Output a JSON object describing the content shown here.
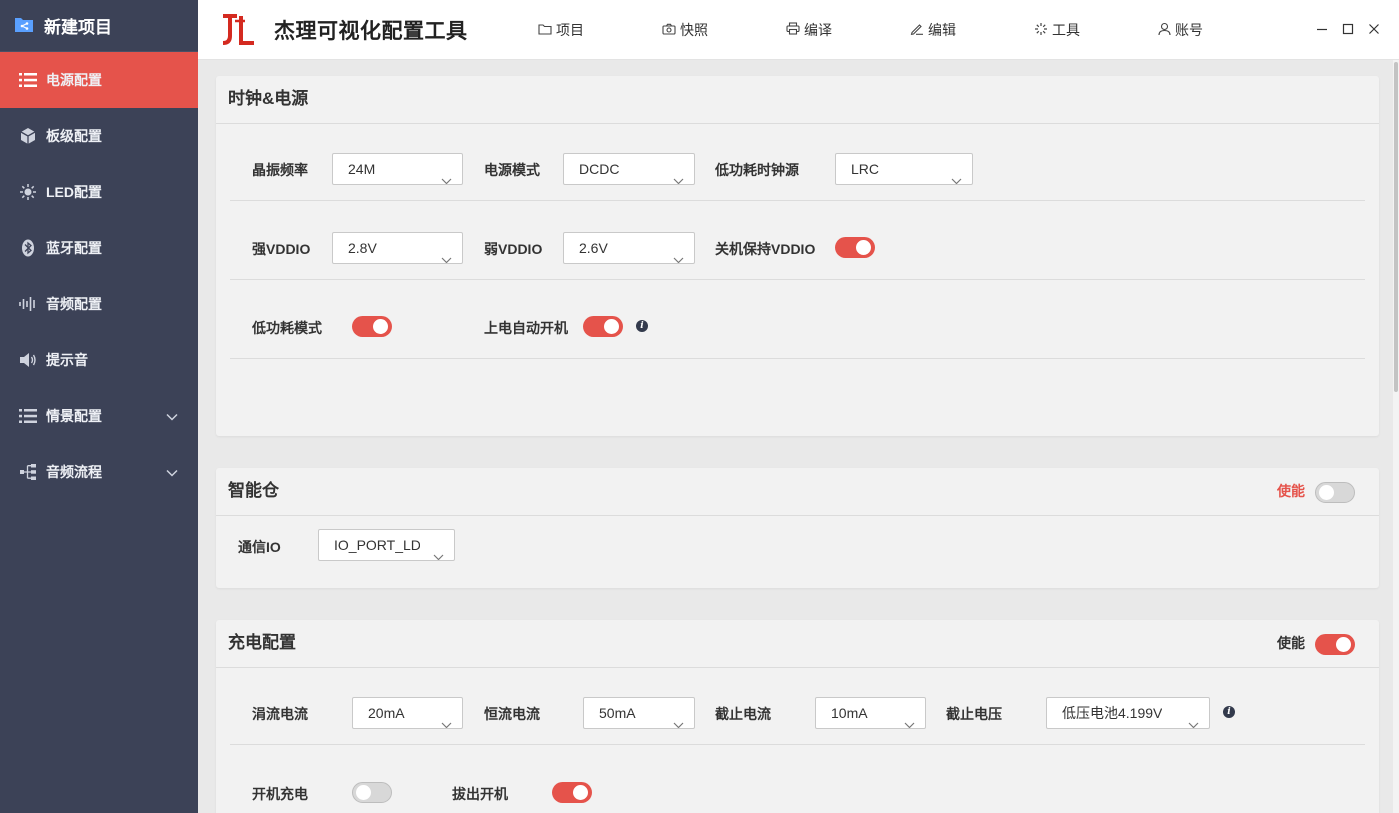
{
  "sidebar": {
    "project_label": "新建项目",
    "items": [
      {
        "label": "电源配置",
        "icon": "list-icon",
        "active": true
      },
      {
        "label": "板级配置",
        "icon": "cube-icon"
      },
      {
        "label": "LED配置",
        "icon": "light-icon"
      },
      {
        "label": "蓝牙配置",
        "icon": "bluetooth-icon"
      },
      {
        "label": "音频配置",
        "icon": "waveform-icon"
      },
      {
        "label": "提示音",
        "icon": "speaker-icon"
      },
      {
        "label": "情景配置",
        "icon": "list-icon",
        "expandable": true
      },
      {
        "label": "音频流程",
        "icon": "flow-icon",
        "expandable": true
      }
    ]
  },
  "header": {
    "title": "杰理可视化配置工具",
    "menu": [
      {
        "label": "项目",
        "icon": "folder-icon"
      },
      {
        "label": "快照",
        "icon": "camera-icon"
      },
      {
        "label": "编译",
        "icon": "printer-icon"
      },
      {
        "label": "编辑",
        "icon": "pen-icon"
      },
      {
        "label": "工具",
        "icon": "spinner-icon"
      },
      {
        "label": "账号",
        "icon": "user-icon"
      }
    ]
  },
  "clock_power": {
    "title": "时钟&电源",
    "osc_freq": {
      "label": "晶振频率",
      "value": "24M"
    },
    "power_mode": {
      "label": "电源模式",
      "value": "DCDC"
    },
    "lowpower_clock": {
      "label": "低功耗时钟源",
      "value": "LRC"
    },
    "strong_vddio": {
      "label": "强VDDIO",
      "value": "2.8V"
    },
    "weak_vddio": {
      "label": "弱VDDIO",
      "value": "2.6V"
    },
    "keep_vddio": {
      "label": "关机保持VDDIO",
      "on": true
    },
    "lowpower_mode": {
      "label": "低功耗模式",
      "on": true
    },
    "auto_power_on": {
      "label": "上电自动开机",
      "on": true
    }
  },
  "smart_case": {
    "title": "智能仓",
    "enable_label": "使能",
    "enabled": false,
    "comm_io": {
      "label": "通信IO",
      "value": "IO_PORT_LDOIN"
    }
  },
  "charge": {
    "title": "充电配置",
    "enable_label": "使能",
    "enabled": true,
    "trickle": {
      "label": "涓流电流",
      "value": "20mA"
    },
    "constant": {
      "label": "恒流电流",
      "value": "50mA"
    },
    "cutoff_current": {
      "label": "截止电流",
      "value": "10mA"
    },
    "cutoff_voltage": {
      "label": "截止电压",
      "value": "低压电池4.199V"
    },
    "power_on_charge": {
      "label": "开机充电",
      "on": false
    },
    "unplug_power_on": {
      "label": "拔出开机",
      "on": true
    }
  },
  "colors": {
    "accent": "#e5534b",
    "sidebar": "#3c4257"
  }
}
